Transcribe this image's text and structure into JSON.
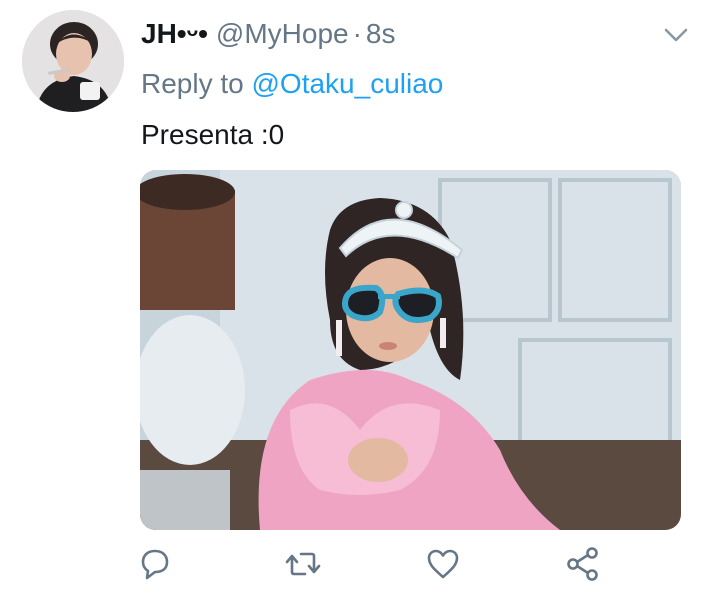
{
  "tweet": {
    "display_name": "JH•ᵕ•",
    "handle": "@MyHope",
    "separator": "·",
    "time": "8s",
    "reply_prefix": "Reply to",
    "reply_handle": "@Otaku_culiao",
    "text": "Presenta :0"
  },
  "icons": {
    "more": "chevron-down-icon",
    "reply": "speech-bubble-icon",
    "retweet": "retweet-icon",
    "like": "heart-icon",
    "share": "share-icon"
  },
  "colors": {
    "text": "#14171a",
    "secondary": "#657786",
    "link": "#1da1f2",
    "icon": "#657786"
  }
}
